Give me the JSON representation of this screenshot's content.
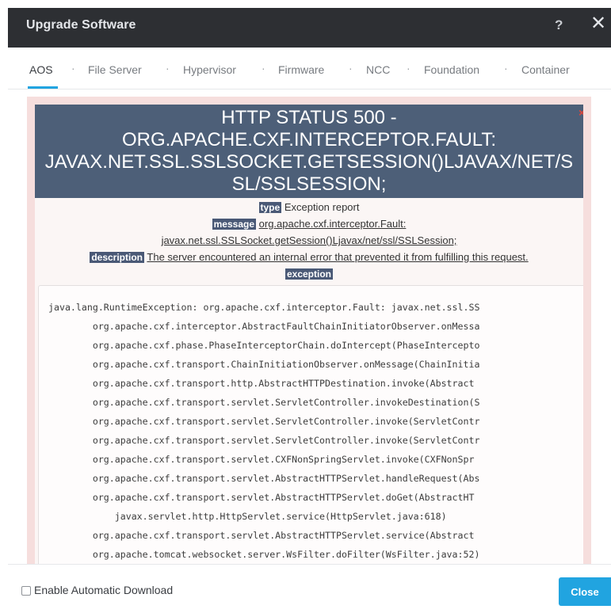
{
  "dialog": {
    "title": "Upgrade Software",
    "help_glyph": "?",
    "close_glyph": "✕"
  },
  "tabs": [
    {
      "label": "AOS",
      "active": true
    },
    {
      "label": "File Server"
    },
    {
      "label": "Hypervisor"
    },
    {
      "label": "Firmware"
    },
    {
      "label": "NCC"
    },
    {
      "label": "Foundation"
    },
    {
      "label": "Container"
    }
  ],
  "tab_separator": "·",
  "error": {
    "banner_close": "×",
    "heading_lines": [
      "HTTP STATUS 500 -",
      "ORG.APACHE.CXF.INTERCEPTOR.FAULT:",
      "JAVAX.NET.SSL.SSLSOCKET.GETSESSION()LJAVAX/NET/S",
      "SL/SSLSESSION;"
    ],
    "type_label": "type",
    "type_value": "Exception report",
    "message_label": "message",
    "message_value_1": "org.apache.cxf.interceptor.Fault:",
    "message_value_2": "javax.net.ssl.SSLSocket.getSession()Ljavax/net/ssl/SSLSession;",
    "description_label": "description",
    "description_value": "The server encountered an internal error that prevented it from fulfilling this request.",
    "exception_label": "exception",
    "trace": [
      "java.lang.RuntimeException: org.apache.cxf.interceptor.Fault: javax.net.ssl.SS",
      "        org.apache.cxf.interceptor.AbstractFaultChainInitiatorObserver.onMessa",
      "        org.apache.cxf.phase.PhaseInterceptorChain.doIntercept(PhaseIntercepto",
      "        org.apache.cxf.transport.ChainInitiationObserver.onMessage(ChainInitia",
      "        org.apache.cxf.transport.http.AbstractHTTPDestination.invoke(Abstract",
      "        org.apache.cxf.transport.servlet.ServletController.invokeDestination(S",
      "        org.apache.cxf.transport.servlet.ServletController.invoke(ServletContr",
      "        org.apache.cxf.transport.servlet.ServletController.invoke(ServletContr",
      "        org.apache.cxf.transport.servlet.CXFNonSpringServlet.invoke(CXFNonSpr",
      "        org.apache.cxf.transport.servlet.AbstractHTTPServlet.handleRequest(Abs",
      "        org.apache.cxf.transport.servlet.AbstractHTTPServlet.doGet(AbstractHT",
      "            javax.servlet.http.HttpServlet.service(HttpServlet.java:618)",
      "        org.apache.cxf.transport.servlet.AbstractHTTPServlet.service(Abstract",
      "        org.apache.tomcat.websocket.server.WsFilter.doFilter(WsFilter.java:52)"
    ]
  },
  "footer": {
    "auto_download_label": "Enable Automatic Download",
    "auto_download_checked": false,
    "close_label": "Close"
  },
  "colors": {
    "title_bar": "#2d2f33",
    "accent": "#21a4e0",
    "error_banner": "#4d5f78",
    "error_border": "#f6dedd"
  }
}
